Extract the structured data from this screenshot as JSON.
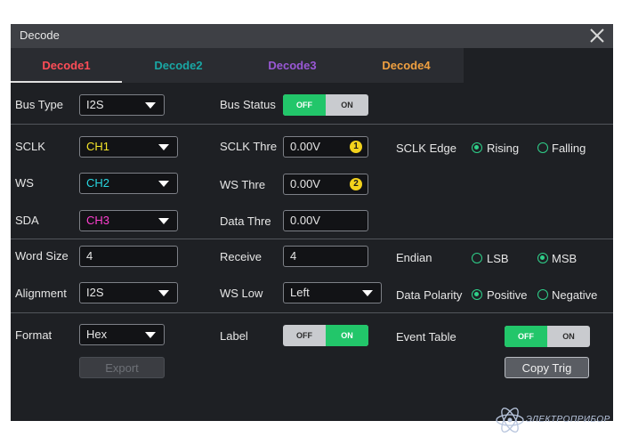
{
  "window": {
    "title": "Decode"
  },
  "tabs": [
    {
      "label": "Decode1",
      "color": "#ff4d57",
      "active": true
    },
    {
      "label": "Decode2",
      "color": "#19a7a4",
      "active": false
    },
    {
      "label": "Decode3",
      "color": "#9a58d6",
      "active": false
    },
    {
      "label": "Decode4",
      "color": "#f0a040",
      "active": false
    }
  ],
  "bus": {
    "type_label": "Bus Type",
    "type_value": "I2S",
    "status_label": "Bus Status",
    "status_off": "OFF",
    "status_on": "ON",
    "status_state": "OFF"
  },
  "sclk": {
    "label": "SCLK",
    "value": "CH1",
    "color": "#f5e52a"
  },
  "sclk_thre": {
    "label": "SCLK Thre",
    "value": "0.00V",
    "badge": "1"
  },
  "sclk_edge": {
    "label": "SCLK Edge",
    "options": [
      "Rising",
      "Falling"
    ],
    "selected": "Rising"
  },
  "ws": {
    "label": "WS",
    "value": "CH2",
    "color": "#28d6e0"
  },
  "ws_thre": {
    "label": "WS Thre",
    "value": "0.00V",
    "badge": "2"
  },
  "sda": {
    "label": "SDA",
    "value": "CH3",
    "color": "#ff3fd0"
  },
  "data_thre": {
    "label": "Data Thre",
    "value": "0.00V"
  },
  "word_size": {
    "label": "Word Size",
    "value": "4"
  },
  "receive": {
    "label": "Receive",
    "value": "4"
  },
  "endian": {
    "label": "Endian",
    "options": [
      "LSB",
      "MSB"
    ],
    "selected": "MSB"
  },
  "alignment": {
    "label": "Alignment",
    "value": "I2S"
  },
  "ws_low": {
    "label": "WS Low",
    "value": "Left"
  },
  "data_polarity": {
    "label": "Data Polarity",
    "options": [
      "Positive",
      "Negative"
    ],
    "selected": "Positive"
  },
  "format": {
    "label": "Format",
    "value": "Hex"
  },
  "label_toggle": {
    "label": "Label",
    "off": "OFF",
    "on": "ON",
    "state": "ON"
  },
  "event_table": {
    "label": "Event Table",
    "off": "OFF",
    "on": "ON",
    "state": "OFF"
  },
  "buttons": {
    "export": "Export",
    "copy_trig": "Copy Trig"
  },
  "watermark": {
    "text": "ЭЛЕКТРОПРИБОР"
  }
}
